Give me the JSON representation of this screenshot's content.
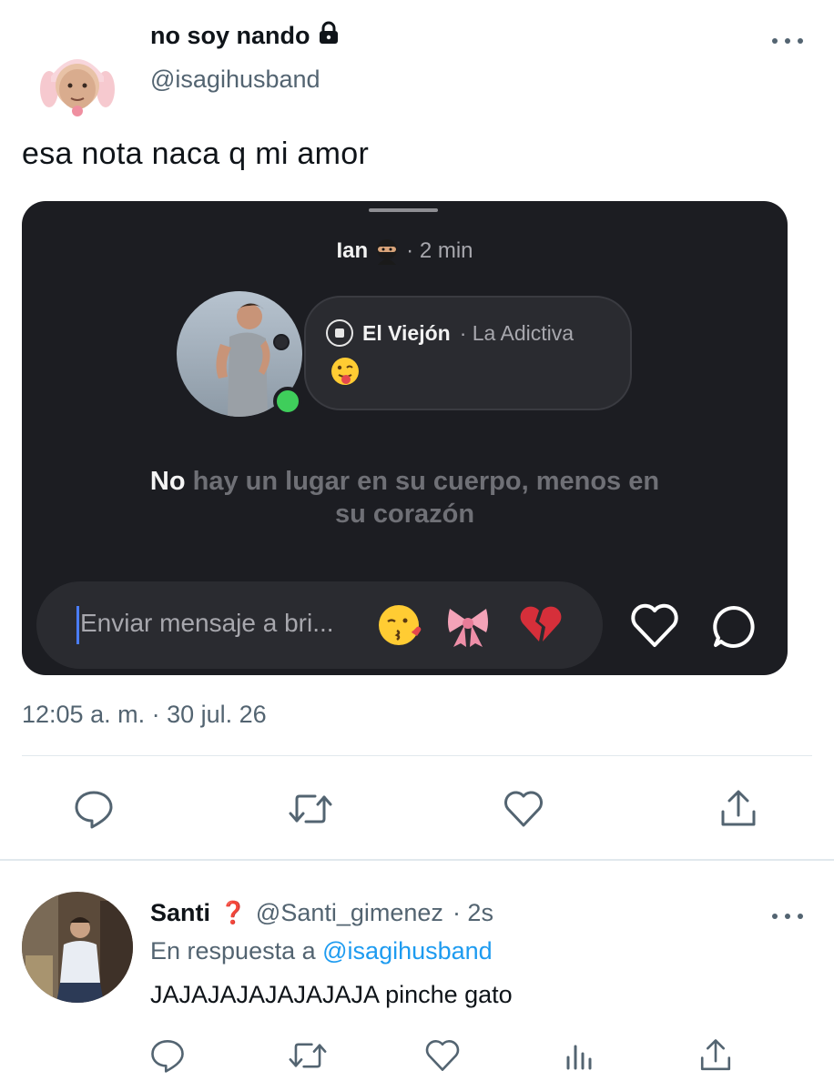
{
  "tweet": {
    "author_name": "no soy nando",
    "author_handle": "@isagihusband",
    "text": "esa nota naca q mi amor",
    "timestamp": "12:05 a. m. · 30 jul. 26",
    "icons": [
      "lock-icon",
      "more-icon",
      "reply-icon",
      "retweet-icon",
      "like-icon",
      "share-icon"
    ]
  },
  "card": {
    "header_user": "Ian",
    "header_time": "· 2 min",
    "note": {
      "song": "El Viejón",
      "artist": "· La Adictiva"
    },
    "lyrics": {
      "active": "No",
      "line1_rest": "hay un lugar en su cuerpo, menos en",
      "line2": "su corazón"
    },
    "message_placeholder": "Enviar mensaje a bri...",
    "colors": {
      "background": "#1c1d22",
      "online": "#3fce5b",
      "caret": "#4a7dff"
    }
  },
  "reply": {
    "author_name": "Santi",
    "badge": "❓",
    "handle": "@Santi_gimenez",
    "time": "· 2s",
    "reply_to_label": "En respuesta a",
    "reply_to_handle": "@isagihusband",
    "text": "JAJAJAJAJAJAJAJA pinche gato"
  },
  "colors": {
    "link": "#1d9bf0",
    "secondary_text": "#536471",
    "divider": "#e1e8ed"
  }
}
